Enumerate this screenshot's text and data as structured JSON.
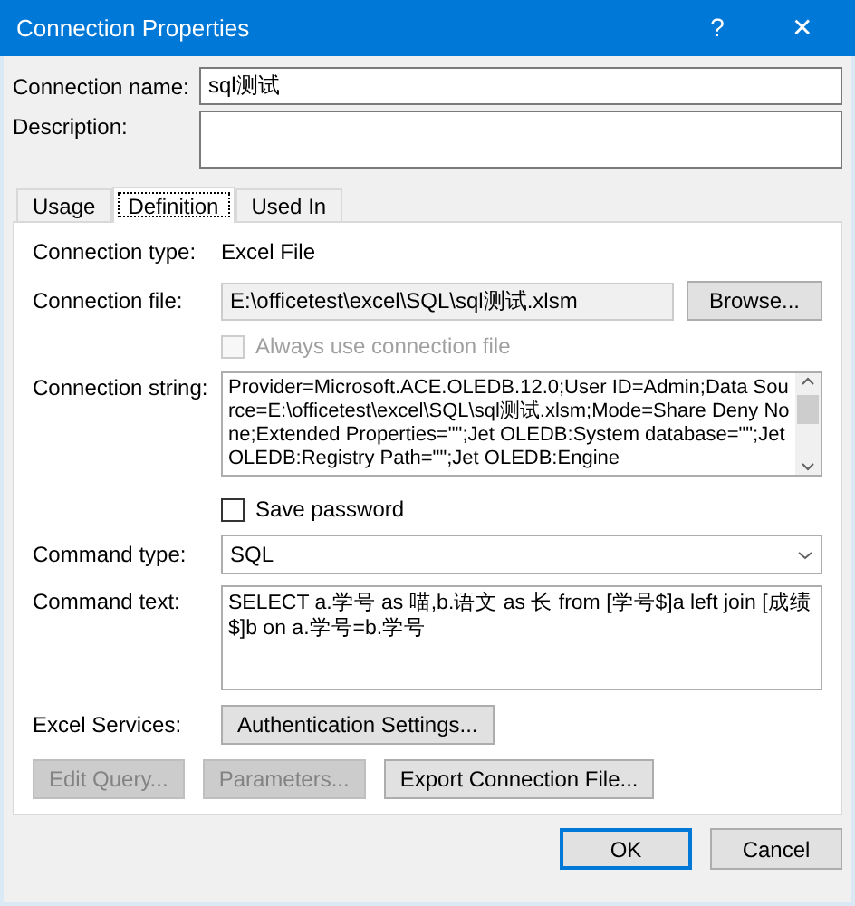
{
  "window": {
    "title": "Connection Properties",
    "help": "?",
    "close": "✕"
  },
  "connection_name": {
    "label": "Connection name:",
    "value": "sql测试"
  },
  "description": {
    "label": "Description:"
  },
  "tabs": [
    {
      "label": "Usage",
      "selected": false
    },
    {
      "label": "Definition",
      "selected": true
    },
    {
      "label": "Used In",
      "selected": false
    }
  ],
  "definition": {
    "connection_type": {
      "label": "Connection type:",
      "value": "Excel File"
    },
    "connection_file": {
      "label": "Connection file:",
      "value": "E:\\officetest\\excel\\SQL\\sql测试.xlsm",
      "button": "Browse..."
    },
    "always_use": {
      "label": "Always use connection file",
      "checked": false,
      "disabled": true
    },
    "connection_string": {
      "label": "Connection string:",
      "value": "Provider=Microsoft.ACE.OLEDB.12.0;User ID=Admin;Data Source=E:\\officetest\\excel\\SQL\\sql测试.xlsm;Mode=Share Deny None;Extended Properties=\"\";Jet OLEDB:System database=\"\";Jet OLEDB:Registry Path=\"\";Jet OLEDB:Engine"
    },
    "save_password": {
      "label": "Save password",
      "checked": false,
      "disabled": false
    },
    "command_type": {
      "label": "Command type:",
      "value": "SQL"
    },
    "command_text": {
      "label": "Command text:",
      "value": "SELECT a.学号 as 喵,b.语文 as 长 from [学号$]a left join [成绩$]b on a.学号=b.学号"
    },
    "excel_services": {
      "label": "Excel Services:",
      "button": "Authentication Settings..."
    },
    "buttons": [
      {
        "label": "Edit Query...",
        "disabled": true
      },
      {
        "label": "Parameters...",
        "disabled": true
      },
      {
        "label": "Export Connection File...",
        "disabled": false
      }
    ]
  },
  "dialog_buttons": [
    {
      "label": "OK",
      "default": true
    },
    {
      "label": "Cancel",
      "default": false
    }
  ]
}
